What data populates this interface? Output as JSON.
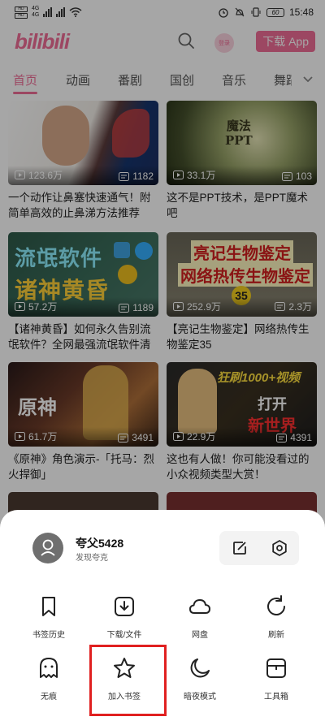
{
  "status_bar": {
    "time": "15:48",
    "sim1": "HD",
    "sim2": "HD",
    "net1": "4G",
    "net2": "4G",
    "battery": "60"
  },
  "header": {
    "logo": "bilibili",
    "login_label": "登录",
    "download_app": "下载 App"
  },
  "tabs": [
    "首页",
    "动画",
    "番剧",
    "国创",
    "音乐",
    "舞蹈"
  ],
  "videos": [
    {
      "views": "123.6万",
      "danmaku": "1182",
      "title": "一个动作让鼻塞快速通气！附简单高效的止鼻涕方法推荐"
    },
    {
      "views": "33.1万",
      "danmaku": "103",
      "title": "这不是PPT技术，是PPT魔术吧",
      "thumb_text": "魔法\nPPT"
    },
    {
      "views": "57.2万",
      "danmaku": "1189",
      "title": "【诸神黄昏】如何永久告别流氓软件？全网最强流氓软件清除...",
      "thumb_text_1": "流氓软件",
      "thumb_text_2": "诸神黄昏"
    },
    {
      "views": "252.9万",
      "danmaku": "2.3万",
      "title": "【亮记生物鉴定】网络热传生物鉴定35",
      "thumb_text_1": "亮记生物鉴定",
      "thumb_text_2": "网络热传生物鉴定",
      "thumb_text_3": "35"
    },
    {
      "views": "61.7万",
      "danmaku": "3491",
      "title": "《原神》角色演示-「托马：烈火捍御」",
      "thumb_text": "原神"
    },
    {
      "views": "22.9万",
      "danmaku": "4391",
      "title": "这也有人做！你可能没看过的小众视频类型大赏！",
      "thumb_text_1": "狂刷1000+视频",
      "thumb_text_2": "打开",
      "thumb_text_3": "新世界"
    }
  ],
  "sheet": {
    "user_name": "夸父5428",
    "user_sub": "发现夸克",
    "menu": [
      {
        "label": "书签历史",
        "icon": "bookmark-icon"
      },
      {
        "label": "下载/文件",
        "icon": "download-icon"
      },
      {
        "label": "网盘",
        "icon": "cloud-icon"
      },
      {
        "label": "刷新",
        "icon": "refresh-icon"
      },
      {
        "label": "无痕",
        "icon": "ghost-icon"
      },
      {
        "label": "加入书签",
        "icon": "star-icon"
      },
      {
        "label": "暗夜模式",
        "icon": "moon-icon"
      },
      {
        "label": "工具箱",
        "icon": "toolbox-icon"
      }
    ]
  },
  "colors": {
    "brand": "#f06d97",
    "highlight": "#e02020"
  }
}
